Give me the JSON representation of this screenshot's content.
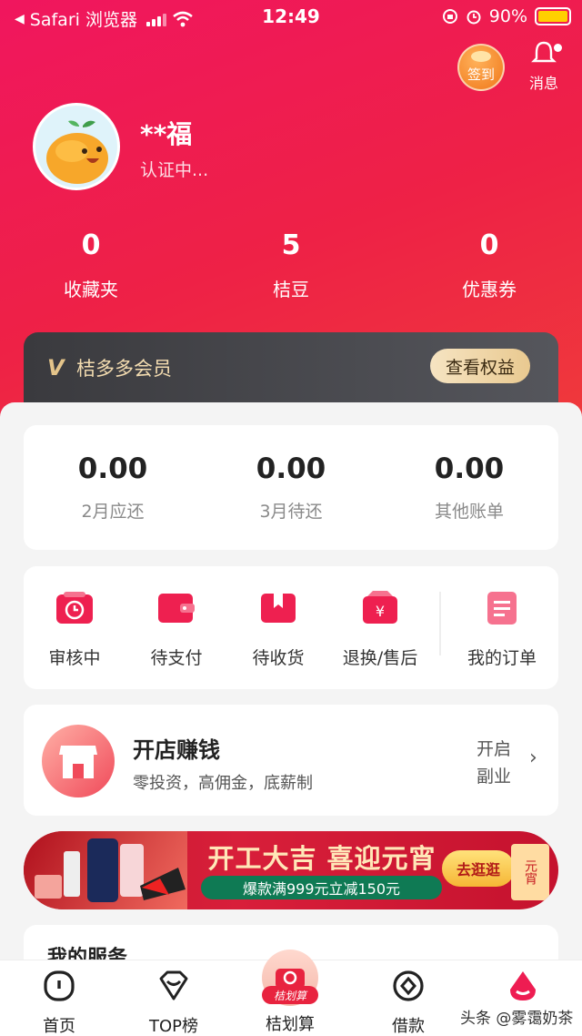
{
  "status_bar": {
    "carrier": "Safari 浏览器",
    "time": "12:49",
    "battery": "90%"
  },
  "header": {
    "checkin_label": "签到",
    "message_label": "消息"
  },
  "profile": {
    "name": "**福",
    "status": "认证中..."
  },
  "stats": [
    {
      "value": "0",
      "label": "收藏夹"
    },
    {
      "value": "5",
      "label": "桔豆"
    },
    {
      "value": "0",
      "label": "优惠券"
    }
  ],
  "vip": {
    "title": "桔多多会员",
    "button": "查看权益"
  },
  "bills": [
    {
      "value": "0.00",
      "label": "2月应还"
    },
    {
      "value": "0.00",
      "label": "3月待还"
    },
    {
      "value": "0.00",
      "label": "其他账单"
    }
  ],
  "orders": [
    {
      "label": "审核中",
      "icon": "clock-icon"
    },
    {
      "label": "待支付",
      "icon": "wallet-icon"
    },
    {
      "label": "待收货",
      "icon": "package-icon"
    },
    {
      "label": "退换/售后",
      "icon": "refund-icon"
    },
    {
      "label": "我的订单",
      "icon": "order-list-icon"
    }
  ],
  "shop": {
    "title": "开店赚钱",
    "subtitle": "零投资，高佣金，底薪制",
    "action": "开启副业"
  },
  "banner": {
    "headline": "开工大吉 喜迎元宵",
    "promo": "爆款满999元立减150元",
    "button": "去逛逛",
    "side_box": "元宵"
  },
  "services": {
    "title": "我的服务"
  },
  "tabbar": [
    {
      "label": "首页",
      "icon": "home-icon"
    },
    {
      "label": "TOP榜",
      "icon": "top-list-icon"
    },
    {
      "label": "桔划算",
      "icon": "deal-icon",
      "badge": "桔划算"
    },
    {
      "label": "借款",
      "icon": "loan-icon"
    },
    {
      "label": "",
      "icon": "mine-icon"
    }
  ],
  "watermark": "头条 @雾霭奶茶",
  "colors": {
    "brand": "#ee1d52",
    "accent_gold": "#e9c990",
    "text_grey": "#8a8a8a"
  }
}
